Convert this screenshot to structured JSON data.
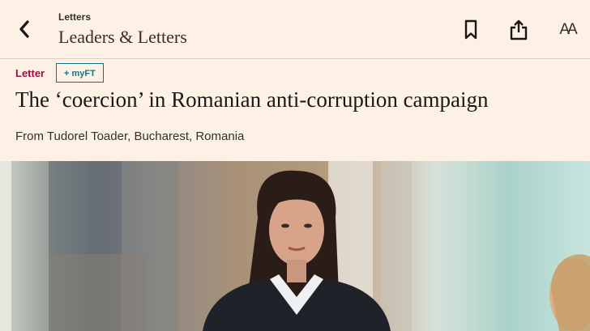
{
  "topbar": {
    "section_small": "Letters",
    "section_title": "Leaders & Letters",
    "back_icon": "chevron-left-icon",
    "bookmark_icon": "bookmark-icon",
    "share_icon": "share-icon",
    "font_size_label": "AA"
  },
  "article": {
    "kicker": "Letter",
    "myft_label": "+ myFT",
    "headline": "The ‘coercion’ in Romanian anti-corruption campaign",
    "byline": "From Tudorel Toader, Bucharest, Romania"
  },
  "colors": {
    "background": "#fdf1e5",
    "kicker": "#990f3d",
    "myft": "#0d7680",
    "text": "#33302e"
  }
}
